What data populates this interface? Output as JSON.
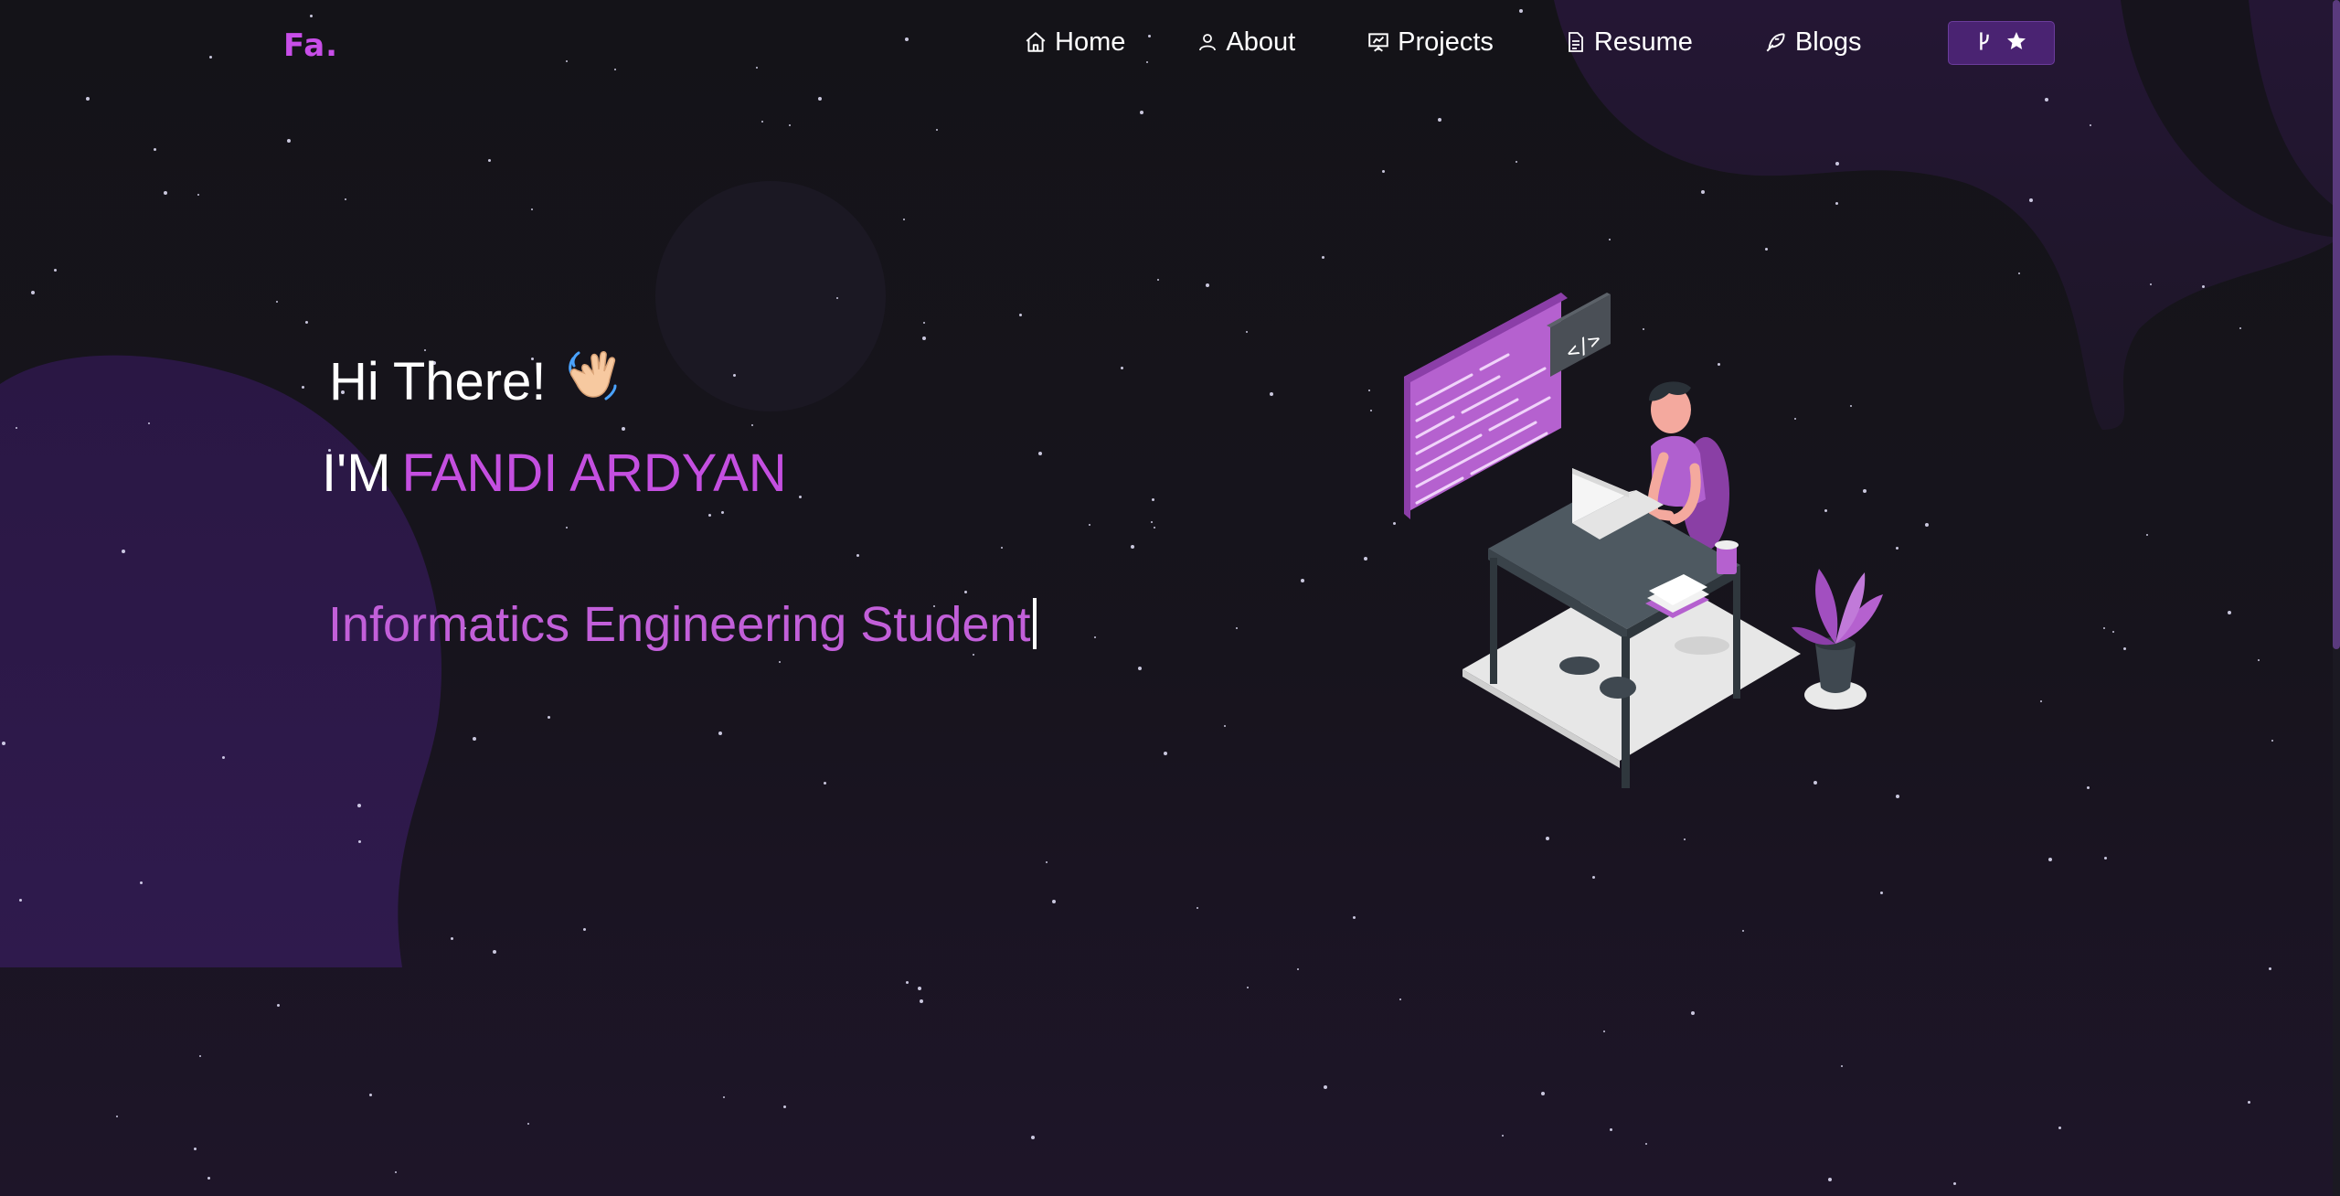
{
  "brand": {
    "logo": "Fa."
  },
  "nav": {
    "items": [
      {
        "label": "Home",
        "icon": "home-icon"
      },
      {
        "label": "About",
        "icon": "user-icon"
      },
      {
        "label": "Projects",
        "icon": "presentation-icon"
      },
      {
        "label": "Resume",
        "icon": "document-icon"
      },
      {
        "label": "Blogs",
        "icon": "feather-icon"
      }
    ],
    "github_button": {
      "icons": [
        "git-fork-icon",
        "star-icon"
      ]
    }
  },
  "hero": {
    "greeting": "Hi There!",
    "greeting_emoji": "👋🏻",
    "intro_prefix": "I'M",
    "name": "FANDI ARDYAN",
    "role": "Informatics Engineering Student"
  },
  "colors": {
    "accent": "#c44fe0",
    "role_text": "#c25fd9",
    "background": "#141318",
    "blob": "#2a1845",
    "button_bg": "#4a2372"
  }
}
